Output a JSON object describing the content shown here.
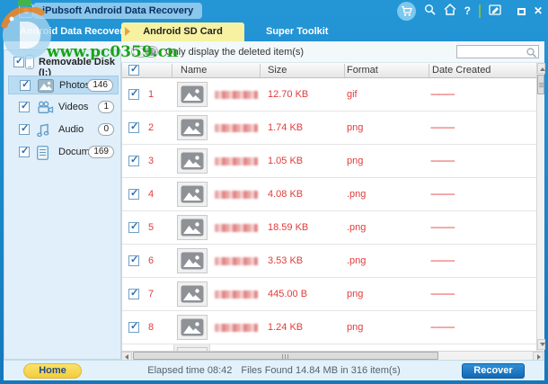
{
  "titlebar": {
    "title": "iPubsoft Android Data Recovery",
    "help_glyph": "?",
    "close_glyph": "✕"
  },
  "tabs": [
    {
      "label": "Android Data Recovery",
      "active": false
    },
    {
      "label": "Android SD Card Recovery",
      "active": true
    },
    {
      "label": "Super Toolkit",
      "active": false
    }
  ],
  "toolbar": {
    "toggle_state": "OFF",
    "filter_label": "Only display the deleted item(s)",
    "search_value": ""
  },
  "sidebar": {
    "root_label": "Removable Disk (I:)",
    "items": [
      {
        "label": "Photos",
        "count": "146",
        "icon": "photos-icon",
        "selected": true
      },
      {
        "label": "Videos",
        "count": "1",
        "icon": "videos-icon",
        "selected": false
      },
      {
        "label": "Audio",
        "count": "0",
        "icon": "audio-icon",
        "selected": false
      },
      {
        "label": "Documents",
        "count": "169",
        "icon": "documents-icon",
        "selected": false
      }
    ]
  },
  "table": {
    "columns": [
      "Name",
      "Size",
      "Format",
      "Date Created"
    ],
    "rows": [
      {
        "num": "1",
        "size": "12.70 KB",
        "format": "gif",
        "date": "----------"
      },
      {
        "num": "2",
        "size": "1.74 KB",
        "format": "png",
        "date": "----------"
      },
      {
        "num": "3",
        "size": "1.05 KB",
        "format": "png",
        "date": "----------"
      },
      {
        "num": "4",
        "size": "4.08 KB",
        "format": ".png",
        "date": "----------"
      },
      {
        "num": "5",
        "size": "18.59 KB",
        "format": ".png",
        "date": "----------"
      },
      {
        "num": "6",
        "size": "3.53 KB",
        "format": ".png",
        "date": "----------"
      },
      {
        "num": "7",
        "size": "445.00 B",
        "format": "png",
        "date": "----------"
      },
      {
        "num": "8",
        "size": "1.24 KB",
        "format": "png",
        "date": "----------"
      }
    ]
  },
  "footer": {
    "home_label": "Home",
    "elapsed": "Elapsed time 08:42",
    "found": "Files Found 14.84 MB in 316 item(s)",
    "recover_label": "Recover"
  },
  "watermark": {
    "text": "www.pc0359.cn"
  },
  "colors": {
    "titlebar_blue": "#1787ce",
    "active_tab_yellow": "#f6f2a2",
    "accent_red": "#e23b3b",
    "watermark_green": "#18a418",
    "home_button_yellow": "#f2cc3c",
    "recover_button_blue": "#1268b4"
  }
}
